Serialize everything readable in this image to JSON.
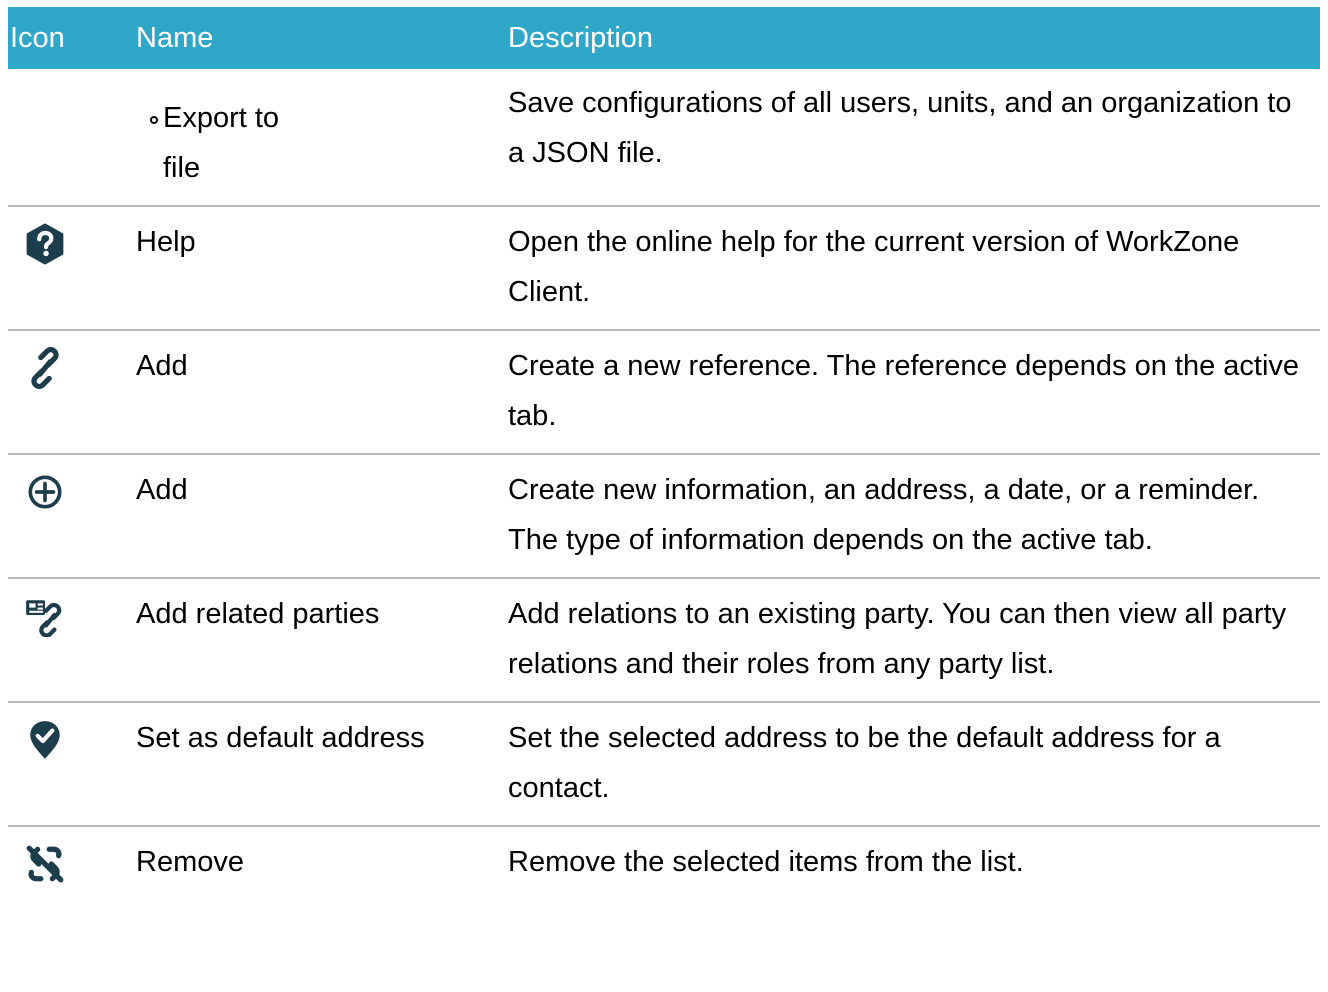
{
  "header": {
    "icon_label": "Icon",
    "name_label": "Name",
    "description_label": "Description"
  },
  "colors": {
    "header_background": "#2ea7c8",
    "header_text": "#ffffff",
    "icon_color": "#1c3d4c",
    "row_divider": "#b8b8b8"
  },
  "rows": [
    {
      "icon": "",
      "name": "",
      "sub_item": "Export to file",
      "description": "Save configurations of all users, units, and an organ­ization to a JSON file."
    },
    {
      "icon": "help-icon",
      "name": "Help",
      "description": "Open the online help for the current version of WorkZone Client."
    },
    {
      "icon": "link-icon",
      "name": "Add",
      "description": "Create a new reference. The reference depends on the active tab."
    },
    {
      "icon": "plus-circle-icon",
      "name": "Add",
      "description": "Create new information, an address, a date, or a reminder. The type of information depends on the active tab."
    },
    {
      "icon": "contact-link-icon",
      "name": "Add related parties",
      "description": "Add relations to an existing party. You can then view all party relations and their roles from any party list."
    },
    {
      "icon": "location-check-icon",
      "name": "Set as default address",
      "description": "Set the selected address to be the default address for a contact."
    },
    {
      "icon": "unlink-icon",
      "name": "Remove",
      "description": "Remove the selected items from the list."
    }
  ]
}
